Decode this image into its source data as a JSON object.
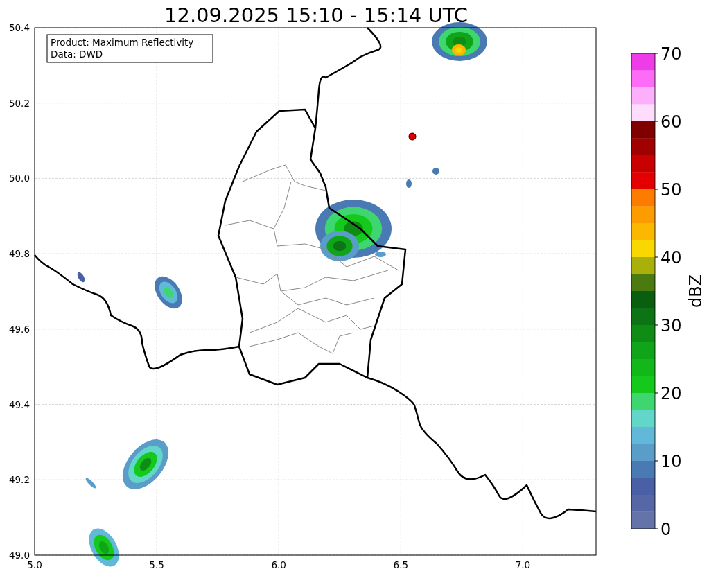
{
  "title": "12.09.2025 15:10 - 15:14 UTC",
  "legend": [
    "Product: Maximum Reflectivity",
    "Data: DWD"
  ],
  "map": {
    "xticks": [
      "5.0",
      "5.5",
      "6.0",
      "6.5",
      "7.0"
    ],
    "yticks": [
      "50.4",
      "50.2",
      "50.0",
      "49.8",
      "49.6",
      "49.4",
      "49.2",
      "49.0"
    ]
  },
  "colorbar": {
    "label": "dBZ",
    "ticks": [
      "70",
      "60",
      "50",
      "40",
      "30",
      "20",
      "10",
      "0"
    ],
    "bins": [
      {
        "color": "#ee3ce8"
      },
      {
        "color": "#fc6cf6"
      },
      {
        "color": "#fcb0fc"
      },
      {
        "color": "#fedcfc"
      },
      {
        "color": "#800000"
      },
      {
        "color": "#a00000"
      },
      {
        "color": "#c80000"
      },
      {
        "color": "#e40000"
      },
      {
        "color": "#fc7c00"
      },
      {
        "color": "#fc9c00"
      },
      {
        "color": "#fcb800"
      },
      {
        "color": "#f8d800"
      },
      {
        "color": "#aab00a"
      },
      {
        "color": "#4a7a10"
      },
      {
        "color": "#0a5e10"
      },
      {
        "color": "#0c7414"
      },
      {
        "color": "#0e8c14"
      },
      {
        "color": "#10a518"
      },
      {
        "color": "#12b81a"
      },
      {
        "color": "#14c81c"
      },
      {
        "color": "#3ed66e"
      },
      {
        "color": "#62d6c8"
      },
      {
        "color": "#62b8d8"
      },
      {
        "color": "#5a9dc8"
      },
      {
        "color": "#4a7ab3"
      },
      {
        "color": "#4960a6"
      },
      {
        "color": "#5667a6"
      },
      {
        "color": "#6474a8"
      }
    ]
  }
}
